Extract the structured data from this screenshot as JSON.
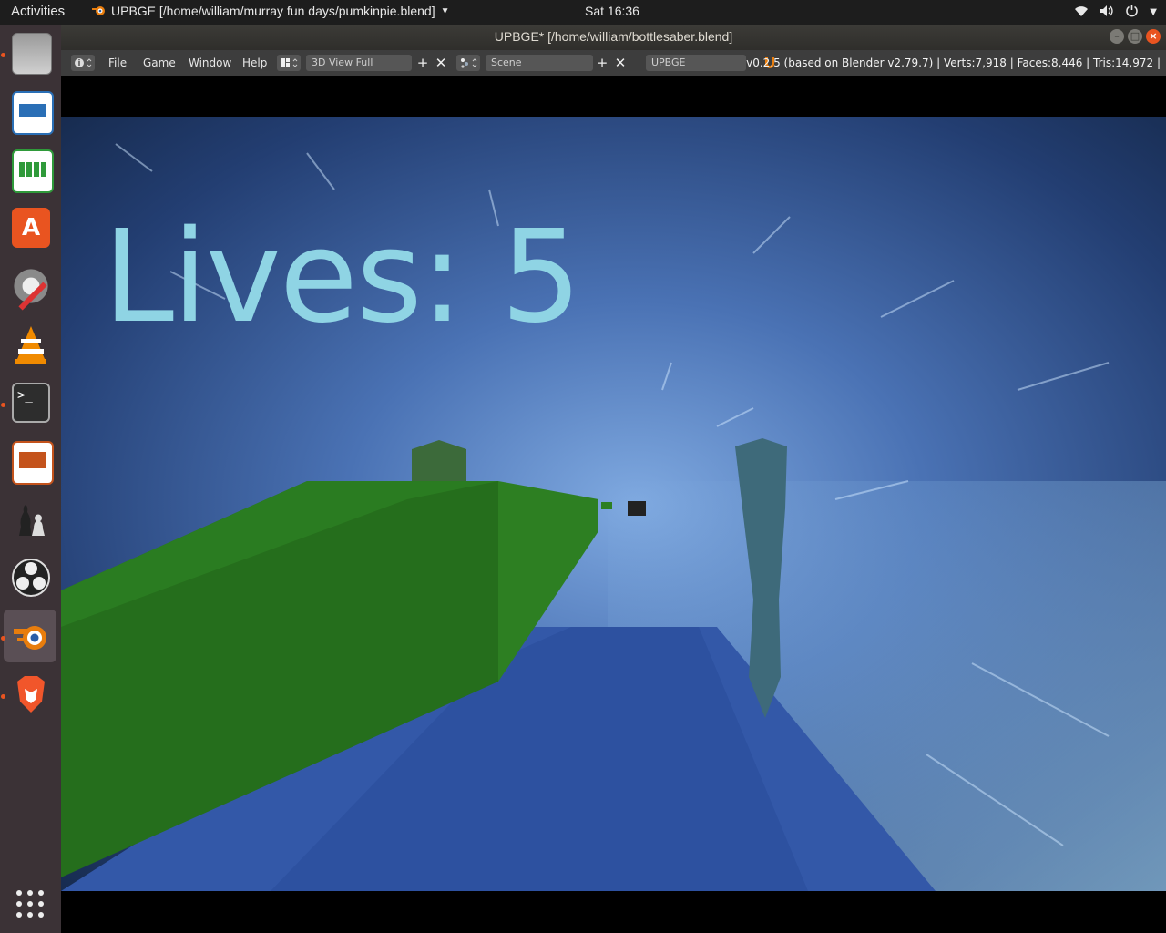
{
  "topbar": {
    "activities": "Activities",
    "app_title": "UPBGE [/home/william/murray fun days/pumkinpie.blend]",
    "clock": "Sat 16:36",
    "tray_icons": [
      "wifi-icon",
      "volume-icon",
      "power-icon",
      "chevron-down-icon"
    ]
  },
  "window": {
    "title": "UPBGE* [/home/william/bottlesaber.blend]"
  },
  "blender_header": {
    "menus": [
      "File",
      "Game",
      "Window",
      "Help"
    ],
    "screen_layout": "3D View Full",
    "scene": "Scene",
    "render_engine": "UPBGE",
    "stats": "v0.2.5 (based on Blender v2.79.7)  | Verts:7,918 | Faces:8,446 | Tris:14,972 |"
  },
  "dock": {
    "apps": [
      {
        "name": "files",
        "running": true
      },
      {
        "name": "writer",
        "running": false
      },
      {
        "name": "calc",
        "running": false
      },
      {
        "name": "software-center",
        "running": false
      },
      {
        "name": "settings",
        "running": false
      },
      {
        "name": "vlc",
        "running": false
      },
      {
        "name": "terminal",
        "running": true
      },
      {
        "name": "impress",
        "running": false
      },
      {
        "name": "chess",
        "running": false
      },
      {
        "name": "obs",
        "running": false
      },
      {
        "name": "blender",
        "running": true,
        "active": true
      },
      {
        "name": "brave",
        "running": true
      }
    ],
    "show_apps_icon": "grid-icon"
  },
  "game": {
    "hud_lives": "Lives: 5"
  },
  "colors": {
    "accent": "#e95420",
    "hud_text": "#8fd4e4",
    "track_green": "#2a7a1e",
    "floor_blue": "#3358a8"
  }
}
